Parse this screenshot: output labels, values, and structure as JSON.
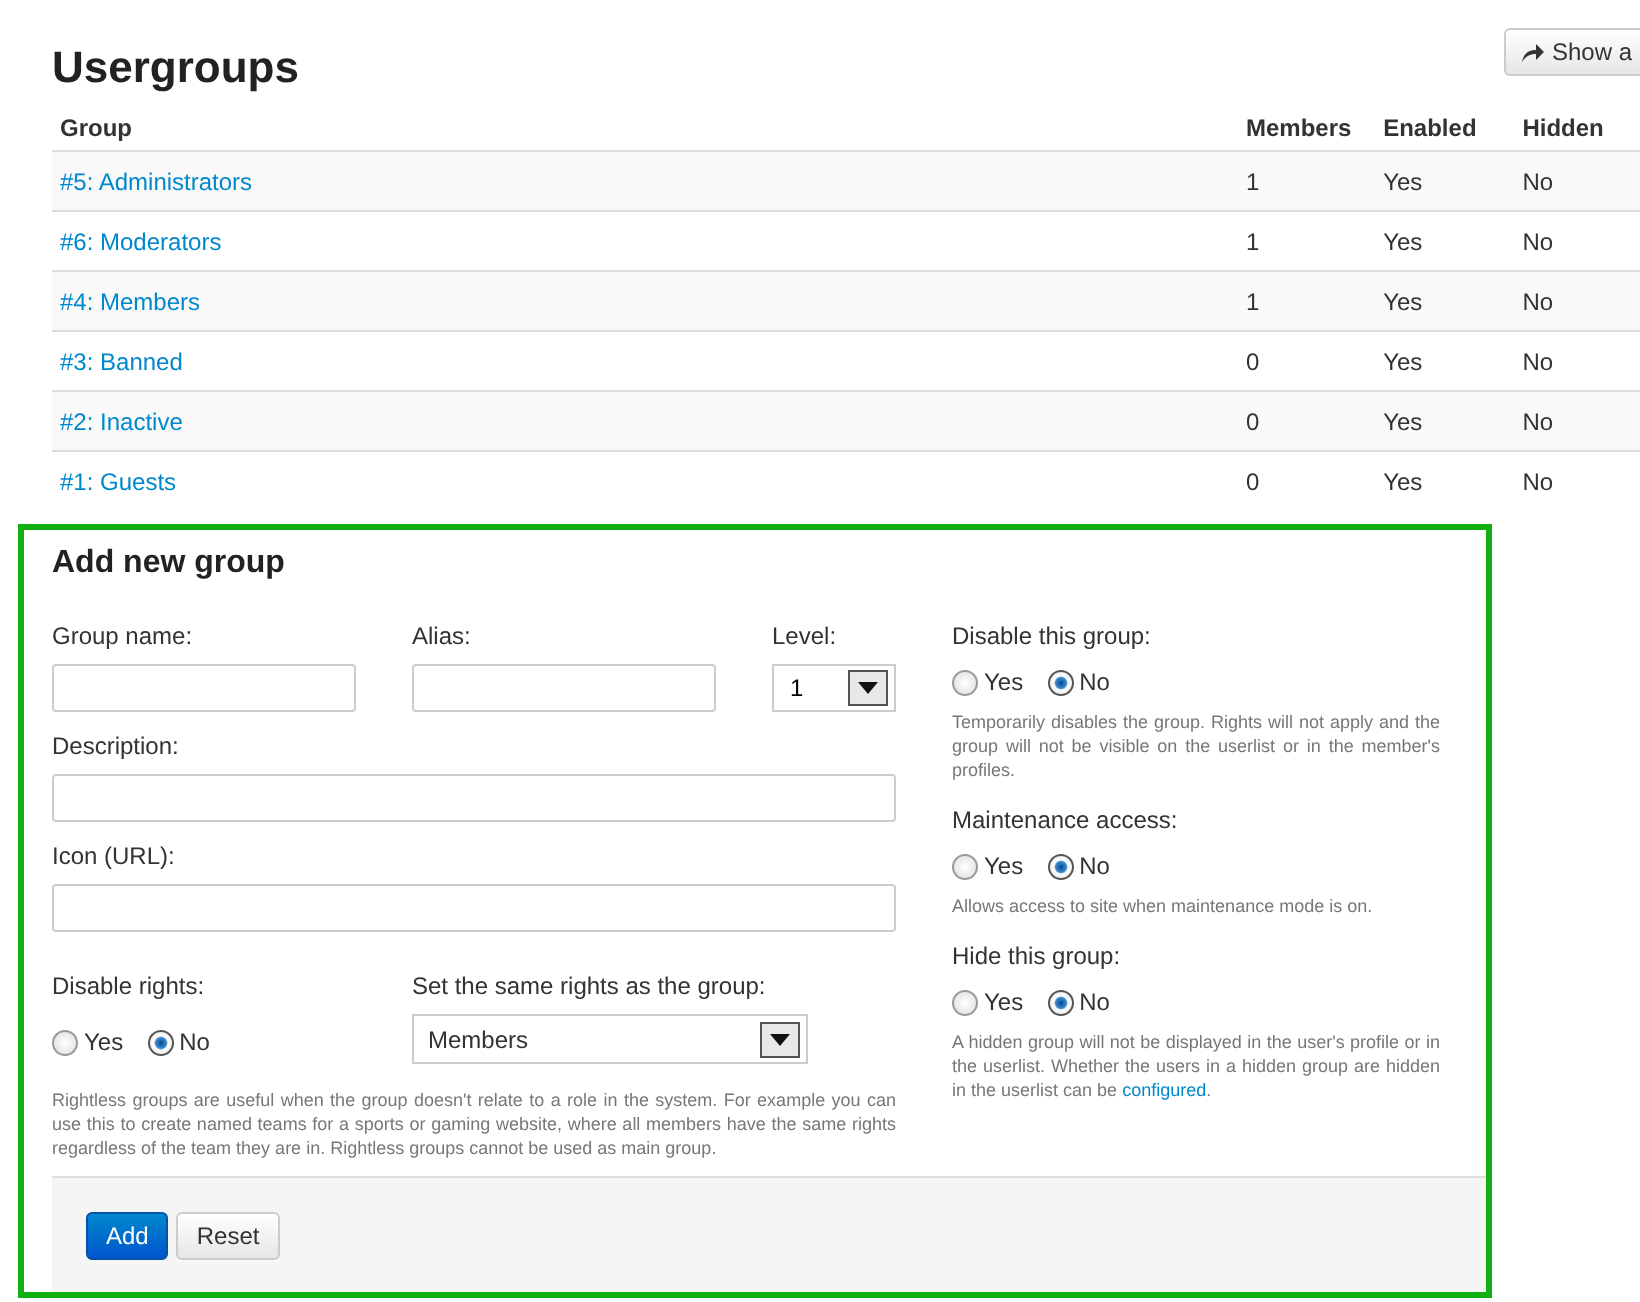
{
  "page_title": "Usergroups",
  "show_button": {
    "label": "Show a"
  },
  "table": {
    "columns": [
      "Group",
      "Members",
      "Enabled",
      "Hidden"
    ],
    "rows": [
      {
        "group": "#5: Administrators",
        "members": "1",
        "enabled": "Yes",
        "hidden": "No"
      },
      {
        "group": "#6: Moderators",
        "members": "1",
        "enabled": "Yes",
        "hidden": "No"
      },
      {
        "group": "#4: Members",
        "members": "1",
        "enabled": "Yes",
        "hidden": "No"
      },
      {
        "group": "#3: Banned",
        "members": "0",
        "enabled": "Yes",
        "hidden": "No"
      },
      {
        "group": "#2: Inactive",
        "members": "0",
        "enabled": "Yes",
        "hidden": "No"
      },
      {
        "group": "#1: Guests",
        "members": "0",
        "enabled": "Yes",
        "hidden": "No"
      }
    ]
  },
  "form": {
    "title": "Add new group",
    "highlighted": true,
    "group_name": {
      "label": "Group name:"
    },
    "alias": {
      "label": "Alias:"
    },
    "level": {
      "label": "Level:",
      "value": "1"
    },
    "description": {
      "label": "Description:"
    },
    "icon_url": {
      "label": "Icon (URL):"
    },
    "disable_rights": {
      "label": "Disable rights:",
      "options": [
        {
          "label": "Yes",
          "selected": false
        },
        {
          "label": "No",
          "selected": true
        }
      ]
    },
    "same_rights": {
      "label": "Set the same rights as the group:",
      "value": "Members"
    },
    "rightless_hint": "Rightless groups are useful when the group doesn't relate to a role in the system. For example you can use this to create named teams for a sports or gaming website, where all members have the same rights regardless of the team they are in. Rightless groups cannot be used as main group.",
    "settings": [
      {
        "label": "Disable this group:",
        "options": [
          {
            "label": "Yes",
            "selected": false
          },
          {
            "label": "No",
            "selected": true
          }
        ],
        "hint": "Temporarily disables the group. Rights will not apply and the group will not be visible on the userlist or in the member's profiles."
      },
      {
        "label": "Maintenance access:",
        "options": [
          {
            "label": "Yes",
            "selected": false
          },
          {
            "label": "No",
            "selected": true
          }
        ],
        "hint": "Allows access to site when maintenance mode is on."
      },
      {
        "label": "Hide this group:",
        "options": [
          {
            "label": "Yes",
            "selected": false
          },
          {
            "label": "No",
            "selected": true
          }
        ],
        "hint": "A hidden group will not be displayed in the user's profile or in the userlist. Whether the users in a hidden group are hidden in the userlist can be",
        "hint_link": "configured",
        "hint_end": "."
      }
    ],
    "buttons": [
      {
        "label": "Add",
        "kind": "primary"
      },
      {
        "label": "Reset",
        "kind": "default"
      }
    ]
  }
}
